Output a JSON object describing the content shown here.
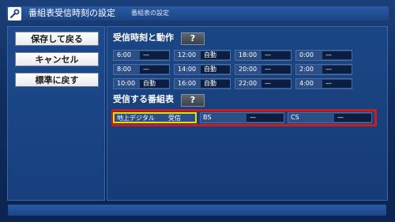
{
  "window": {
    "title": "番組表受信時刻の設定",
    "subtitle": "番組表の設定"
  },
  "menu": {
    "save_label": "保存して戻る",
    "cancel_label": "キャンセル",
    "reset_label": "標準に戻す"
  },
  "schedule": {
    "title": "受信時刻と動作",
    "help_label": "?",
    "cells": [
      {
        "time": "6:00",
        "action": "—"
      },
      {
        "time": "12:00",
        "action": "自動"
      },
      {
        "time": "18:00",
        "action": "—"
      },
      {
        "time": "0:00",
        "action": "—"
      },
      {
        "time": "8:00",
        "action": "—"
      },
      {
        "time": "14:00",
        "action": "自動"
      },
      {
        "time": "20:00",
        "action": "—"
      },
      {
        "time": "2:00",
        "action": "—"
      },
      {
        "time": "10:00",
        "action": "自動"
      },
      {
        "time": "16:00",
        "action": "自動"
      },
      {
        "time": "22:00",
        "action": "—"
      },
      {
        "time": "4:00",
        "action": "—"
      }
    ]
  },
  "channels": {
    "title": "受信する番組表",
    "help_label": "?",
    "items": [
      {
        "name": "地上デジタル",
        "value": "受信"
      },
      {
        "name": "BS",
        "value": "—"
      },
      {
        "name": "CS",
        "value": "—"
      }
    ]
  },
  "colors": {
    "highlight_border": "#d11a1a",
    "selected_border": "#e5e000",
    "panel_bg": "#1b4685"
  }
}
